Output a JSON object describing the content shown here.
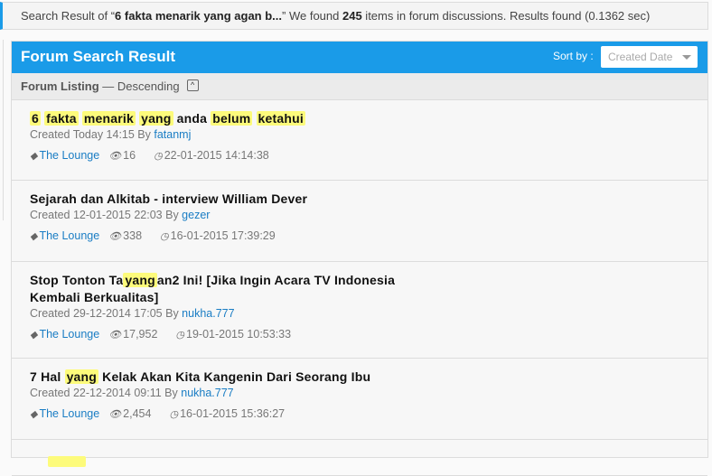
{
  "search": {
    "prefix": "Search Result of “",
    "query": "6 fakta menarik yang agan b...",
    "mid": "” We found ",
    "count": "245",
    "suffix": " items in forum discussions. Results found (0.1362 sec)"
  },
  "panel": {
    "title": "Forum Search Result",
    "sort_label": "Sort by :",
    "sort_value": "Created Date"
  },
  "listing": {
    "label": "Forum Listing",
    "order": " — Descending"
  },
  "items": [
    {
      "title": [
        {
          "t": "6",
          "hl": true
        },
        {
          "t": " "
        },
        {
          "t": "fakta",
          "hl": true
        },
        {
          "t": " "
        },
        {
          "t": "menarik",
          "hl": true
        },
        {
          "t": " "
        },
        {
          "t": "yang",
          "hl": true
        },
        {
          "t": " anda "
        },
        {
          "t": "belum",
          "hl": true
        },
        {
          "t": " "
        },
        {
          "t": "ketahui",
          "hl": true
        }
      ],
      "created": "Created Today 14:15 By ",
      "author": "fatanmj",
      "forum": "The Lounge",
      "views": "16",
      "updated": "22-01-2015 14:14:38"
    },
    {
      "title": [
        {
          "t": "Sejarah dan Alkitab - interview William Dever"
        }
      ],
      "created": "Created 12-01-2015 22:03 By ",
      "author": "gezer",
      "forum": "The Lounge",
      "views": "338",
      "updated": "16-01-2015 17:39:29"
    },
    {
      "title": [
        {
          "t": "Stop Tonton Ta"
        },
        {
          "t": "yang",
          "hl": true
        },
        {
          "t": "an2 Ini! [Jika Ingin Acara TV Indonesia Kembali Berkualitas]"
        }
      ],
      "created": "Created 29-12-2014 17:05 By ",
      "author": "nukha.777",
      "forum": "The Lounge",
      "views": "17,952",
      "updated": "19-01-2015 10:53:33"
    },
    {
      "title": [
        {
          "t": "7 Hal "
        },
        {
          "t": "yang",
          "hl": true
        },
        {
          "t": " Kelak Akan Kita Kangenin Dari Seorang Ibu"
        }
      ],
      "created": "Created 22-12-2014 09:11 By ",
      "author": "nukha.777",
      "forum": "The Lounge",
      "views": "2,454",
      "updated": "16-01-2015 15:36:27"
    }
  ]
}
